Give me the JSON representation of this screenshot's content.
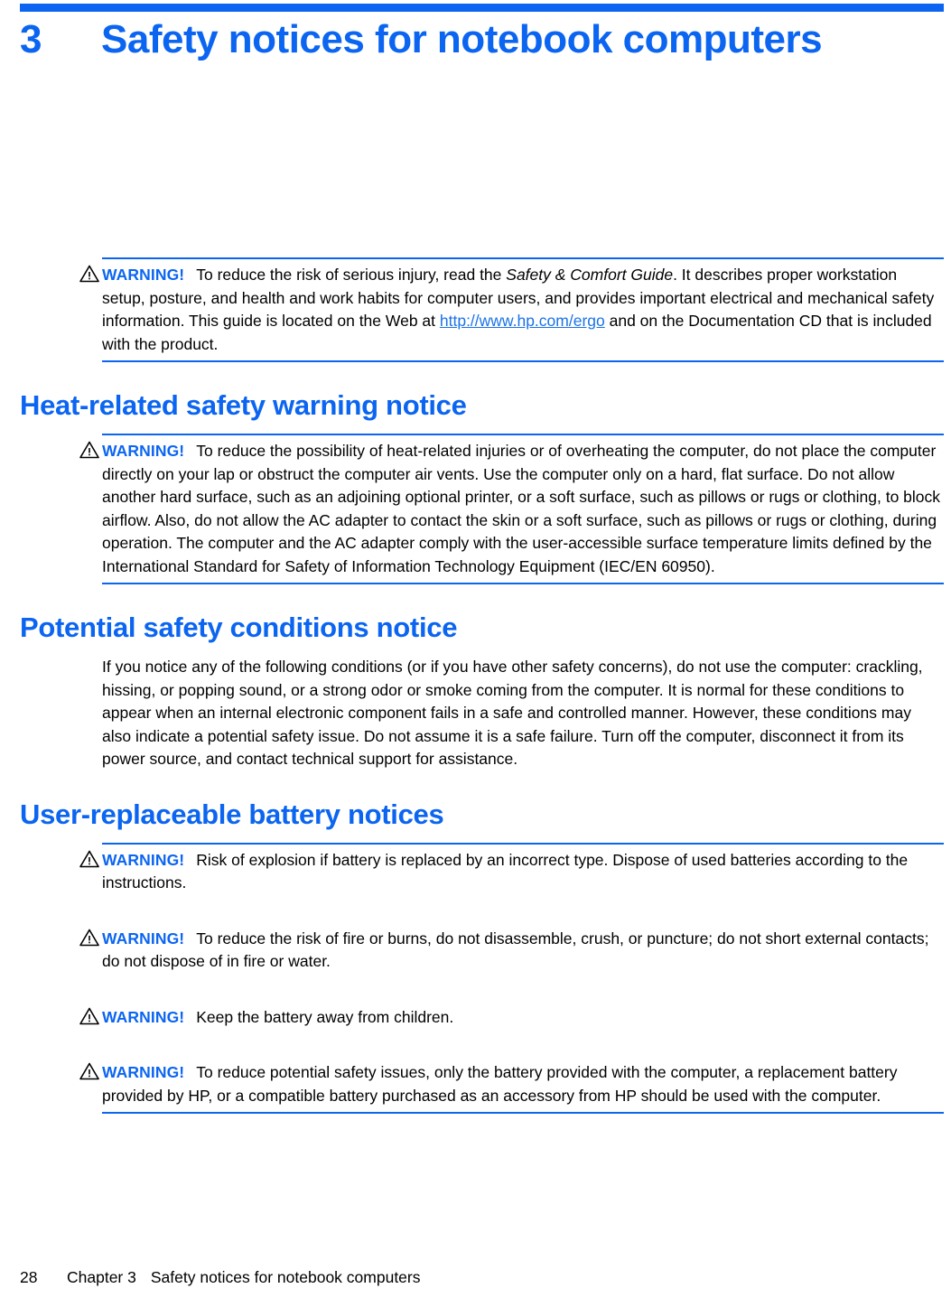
{
  "theme": {
    "accent_blue": "#0b65f1",
    "link_blue": "#1a73e8",
    "text_black": "#000000",
    "page_background": "#ffffff"
  },
  "chapter": {
    "number": "3",
    "title": "Safety notices for notebook computers"
  },
  "icons": {
    "warning_triangle": "warning-triangle-icon"
  },
  "notes": {
    "comfort_guide": {
      "label": "WARNING!",
      "text_before_italic": "To reduce the risk of serious injury, read the ",
      "italic_text": "Safety & Comfort Guide",
      "text_after_italic": ". It describes proper workstation setup, posture, and health and work habits for computer users, and provides important electrical and mechanical safety information. This guide is located on the Web at ",
      "link_text": "http://www.hp.com/ergo",
      "text_after_link": " and on the Documentation CD that is included with the product."
    }
  },
  "sections": [
    {
      "heading": "Heat-related safety warning notice",
      "note": {
        "label": "WARNING!",
        "text": "To reduce the possibility of heat-related injuries or of overheating the computer, do not place the computer directly on your lap or obstruct the computer air vents. Use the computer only on a hard, flat surface. Do not allow another hard surface, such as an adjoining optional printer, or a soft surface, such as pillows or rugs or clothing, to block airflow. Also, do not allow the AC adapter to contact the skin or a soft surface, such as pillows or rugs or clothing, during operation. The computer and the AC adapter comply with the user-accessible surface temperature limits defined by the International Standard for Safety of Information Technology Equipment (IEC/EN 60950)."
      }
    },
    {
      "heading": "Potential safety conditions notice",
      "paragraph": "If you notice any of the following conditions (or if you have other safety concerns), do not use the computer: crackling, hissing, or popping sound, or a strong odor or smoke coming from the computer. It is normal for these conditions to appear when an internal electronic component fails in a safe and controlled manner. However, these conditions may also indicate a potential safety issue. Do not assume it is a safe failure. Turn off the computer, disconnect it from its power source, and contact technical support for assistance."
    },
    {
      "heading": "User-replaceable battery notices",
      "notes": [
        {
          "label": "WARNING!",
          "text": "Risk of explosion if battery is replaced by an incorrect type. Dispose of used batteries according to the instructions."
        },
        {
          "label": "WARNING!",
          "text": "To reduce the risk of fire or burns, do not disassemble, crush, or puncture; do not short external contacts; do not dispose of in fire or water."
        },
        {
          "label": "WARNING!",
          "text": "Keep the battery away from children."
        },
        {
          "label": "WARNING!",
          "text": "To reduce potential safety issues, only the battery provided with the computer, a replacement battery provided by HP, or a compatible battery purchased as an accessory from HP should be used with the computer."
        }
      ]
    }
  ],
  "footer": {
    "page_number": "28",
    "chapter_label": "Chapter 3",
    "chapter_title": "Safety notices for notebook computers"
  }
}
